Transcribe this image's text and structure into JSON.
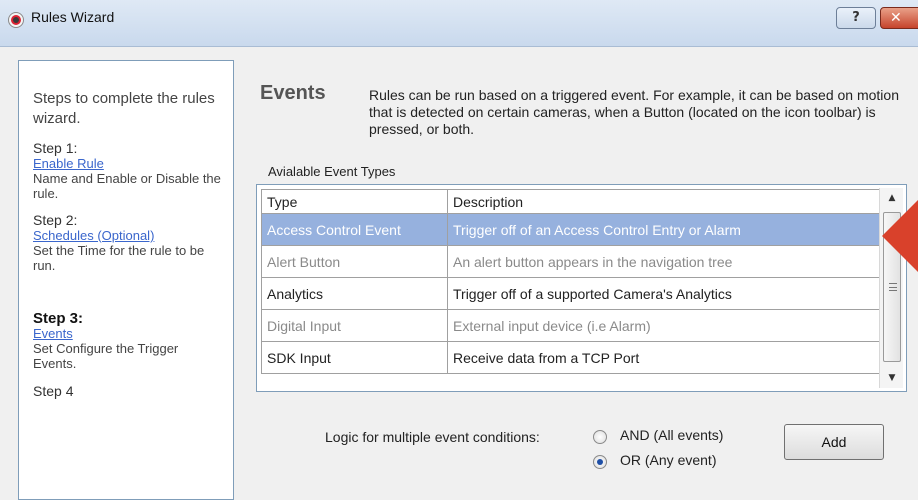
{
  "window": {
    "title": "Rules Wizard",
    "help_label": "?",
    "close_label": "✕"
  },
  "steps": {
    "intro": "Steps to complete the rules wizard.",
    "items": [
      {
        "head": "Step 1:",
        "link": "Enable Rule",
        "desc": "Name and Enable or Disable the rule."
      },
      {
        "head": "Step 2:",
        "link": "Schedules (Optional)",
        "desc": "Set the Time for the rule to be run."
      },
      {
        "head": "Step 3:",
        "link": "Events",
        "desc": "Set Configure the Trigger Events."
      }
    ],
    "next_partial": "Step 4"
  },
  "events": {
    "title": "Events",
    "description": "Rules can be run based on a triggered event. For example, it can be based on motion that is detected on certain cameras, when a Button (located on the icon toolbar) is pressed, or both.",
    "table_label": "Avialable Event Types",
    "columns": [
      "Type",
      "Description"
    ],
    "rows": [
      {
        "type": "Access Control Event",
        "description": "Trigger off of an Access Control Entry or Alarm",
        "state": "selected"
      },
      {
        "type": "Alert Button",
        "description": "An alert button appears in the navigation tree",
        "state": "disabled"
      },
      {
        "type": "Analytics",
        "description": "Trigger off of a supported Camera's Analytics",
        "state": "normal"
      },
      {
        "type": "Digital Input",
        "description": "External input device (i.e Alarm)",
        "state": "disabled"
      },
      {
        "type": "SDK Input",
        "description": "Receive data from a TCP Port",
        "state": "normal"
      }
    ]
  },
  "logic": {
    "label": "Logic for multiple event conditions:",
    "options": [
      {
        "label": "AND (All events)",
        "checked": false
      },
      {
        "label": "OR (Any event)",
        "checked": true
      }
    ],
    "add_label": "Add"
  },
  "colors": {
    "selection": "#96b1de",
    "link": "#3a66cc",
    "annotation_arrow": "#d9412b"
  }
}
